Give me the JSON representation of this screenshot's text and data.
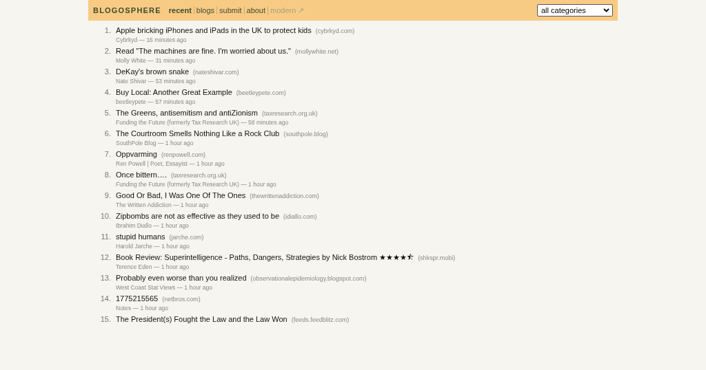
{
  "header": {
    "logo": "BLOGOSPHERE",
    "nav": [
      {
        "label": "recent",
        "selected": true,
        "external": false
      },
      {
        "label": "blogs",
        "selected": false,
        "external": false
      },
      {
        "label": "submit",
        "selected": false,
        "external": false
      },
      {
        "label": "about",
        "selected": false,
        "external": false
      },
      {
        "label": "modern ↗",
        "selected": false,
        "external": true
      }
    ],
    "category_select": {
      "value": "all categories"
    }
  },
  "posts": [
    {
      "number": "1.",
      "title": "Apple bricking iPhones and iPads in the UK to protect kids",
      "domain": "(cybrkyd.com)",
      "meta": "Cybrkyd — 16 minutes ago"
    },
    {
      "number": "2.",
      "title": "Read \"The machines are fine. I'm worried about us.\"",
      "domain": "(mollywhite.net)",
      "meta": "Molly White — 31 minutes ago"
    },
    {
      "number": "3.",
      "title": "DeKay's brown snake",
      "domain": "(nateshivar.com)",
      "meta": "Nate Shivar — 53 minutes ago"
    },
    {
      "number": "4.",
      "title": "Buy Local: Another Great Example",
      "domain": "(beetleypete.com)",
      "meta": "beetleypete — 57 minutes ago"
    },
    {
      "number": "5.",
      "title": "The Greens, antisemitism and antiZionism",
      "domain": "(taxresearch.org.uk)",
      "meta": "Funding the Future (formerly Tax Research UK) — 58 minutes ago"
    },
    {
      "number": "6.",
      "title": "The Courtroom Smells Nothing Like a Rock Club",
      "domain": "(southpole.blog)",
      "meta": "SouthPole Blog — 1 hour ago"
    },
    {
      "number": "7.",
      "title": "Oppvarming",
      "domain": "(renpowell.com)",
      "meta": "Ren Powell | Poet, Essayist — 1 hour ago"
    },
    {
      "number": "8.",
      "title": "Once bittern….",
      "domain": "(taxresearch.org.uk)",
      "meta": "Funding the Future (formerly Tax Research UK) — 1 hour ago"
    },
    {
      "number": "9.",
      "title": "Good Or Bad, I Was One Of The Ones",
      "domain": "(thewrittenaddiction.com)",
      "meta": "The Written Addiction — 1 hour ago"
    },
    {
      "number": "10.",
      "title": "Zipbombs are not as effective as they used to be",
      "domain": "(idiallo.com)",
      "meta": "Ibrahim Diallo — 1 hour ago"
    },
    {
      "number": "11.",
      "title": "stupid humans",
      "domain": "(jarche.com)",
      "meta": "Harold Jarche — 1 hour ago"
    },
    {
      "number": "12.",
      "title": "Book Review: Superintelligence - Paths, Dangers, Strategies by Nick Bostrom ★★★★⯪",
      "domain": "(shkspr.mobi)",
      "meta": "Terence Eden — 1 hour ago"
    },
    {
      "number": "13.",
      "title": "Probably even worse than you realized",
      "domain": "(observationalepidemiology.blogspot.com)",
      "meta": "West Coast Stat Views — 1 hour ago"
    },
    {
      "number": "14.",
      "title": "1775215565",
      "domain": "(netbros.com)",
      "meta": "Notes — 1 hour ago"
    },
    {
      "number": "15.",
      "title": "The President(s) Fought the Law and the Law Won",
      "domain": "(feeds.feedblitz.com)"
    }
  ]
}
